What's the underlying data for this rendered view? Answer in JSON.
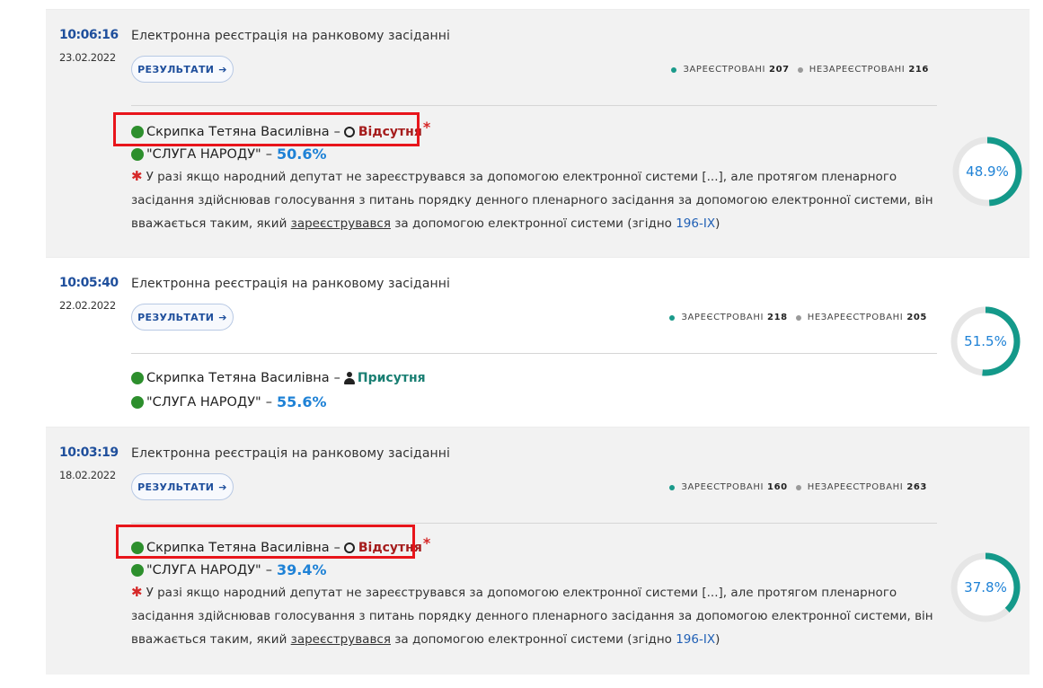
{
  "labels": {
    "results": "РЕЗУЛЬТАТИ",
    "registered": "ЗАРЕЄСТРОВАНІ",
    "unregistered": "НЕЗАРЕЄСТРОВАНІ",
    "dash": "–",
    "absent": "Відсутня",
    "present": "Присутня",
    "star": "*",
    "note_part1": "У разі якщо народний депутат не зареєструвався за допомогою електронної системи [...], але протягом пленарного засідання здійснював голосування з питань порядку денного пленарного засідання за допомогою електронної системи, він вважається таким, який ",
    "note_underlined": "зареєструвався",
    "note_part2": " за допомогою електронної системи (згідно ",
    "note_link": "196-IX",
    "note_end": ")"
  },
  "colors": {
    "ring_track": "#e6e6e6",
    "ring_fill": "#14998a",
    "highlight": "#e8151b",
    "time": "#1f4f9c",
    "percent": "#1f82d6"
  },
  "sessions": [
    {
      "time": "10:06:16",
      "date": "23.02.2022",
      "title": "Електронна реєстрація на ранковому засіданні",
      "registered_count": "207",
      "unregistered_count": "216",
      "deputy": "Скрипка Тетяна Василівна",
      "status": "absent",
      "party": "\"СЛУГА НАРОДУ\"",
      "party_percent": "50.6%",
      "ring_label": "48.9%",
      "ring_fraction": 0.489,
      "highlighted": true
    },
    {
      "time": "10:05:40",
      "date": "22.02.2022",
      "title": "Електронна реєстрація на ранковому засіданні",
      "registered_count": "218",
      "unregistered_count": "205",
      "deputy": "Скрипка Тетяна Василівна",
      "status": "present",
      "party": "\"СЛУГА НАРОДУ\"",
      "party_percent": "55.6%",
      "ring_label": "51.5%",
      "ring_fraction": 0.515,
      "highlighted": false
    },
    {
      "time": "10:03:19",
      "date": "18.02.2022",
      "title": "Електронна реєстрація на ранковому засіданні",
      "registered_count": "160",
      "unregistered_count": "263",
      "deputy": "Скрипка Тетяна Василівна",
      "status": "absent",
      "party": "\"СЛУГА НАРОДУ\"",
      "party_percent": "39.4%",
      "ring_label": "37.8%",
      "ring_fraction": 0.378,
      "highlighted": true
    }
  ]
}
